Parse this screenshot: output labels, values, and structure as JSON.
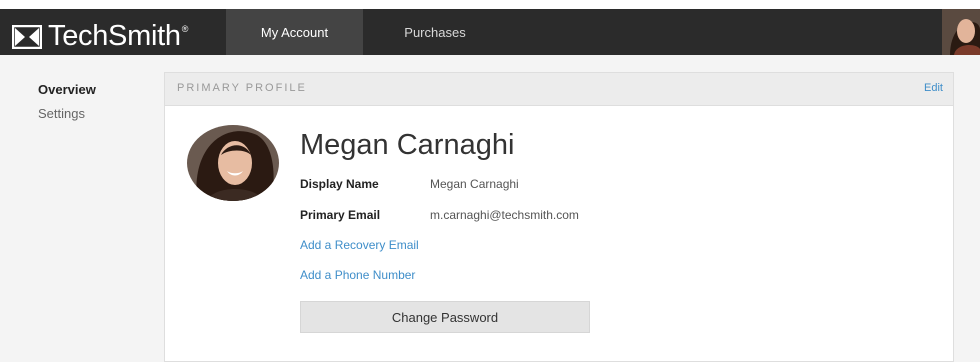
{
  "header": {
    "brand": "TechSmith",
    "brand_mark": "®",
    "tabs": [
      {
        "label": "My Account",
        "active": true
      },
      {
        "label": "Purchases",
        "active": false
      }
    ],
    "user_avatar_icon": "user-avatar"
  },
  "sidebar": {
    "items": [
      {
        "label": "Overview",
        "active": true
      },
      {
        "label": "Settings",
        "active": false
      }
    ]
  },
  "profile": {
    "section_title": "PRIMARY PROFILE",
    "edit_label": "Edit",
    "name": "Megan Carnaghi",
    "display_name_label": "Display Name",
    "display_name": "Megan Carnaghi",
    "primary_email_label": "Primary Email",
    "primary_email": "m.carnaghi@techsmith.com",
    "add_recovery_email": "Add a Recovery Email",
    "add_phone_number": "Add a Phone Number",
    "change_password": "Change Password"
  },
  "colors": {
    "topbar": "#2b2b2b",
    "active_tab": "#444444",
    "link": "#3f8ec9",
    "button": "#e4e4e4"
  }
}
